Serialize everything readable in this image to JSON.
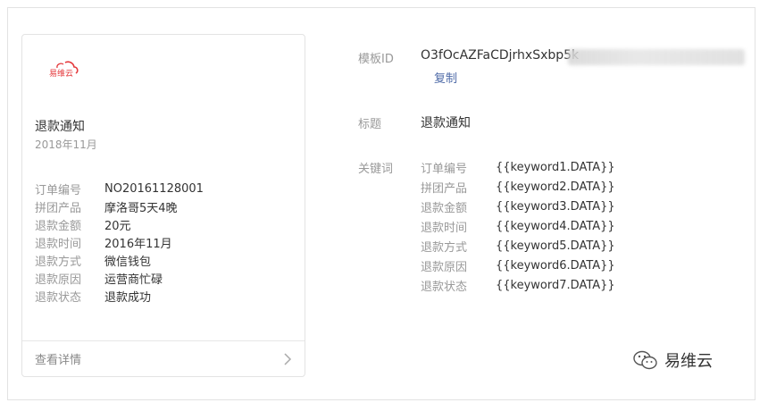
{
  "card": {
    "logo_text": "易维云",
    "title": "退款通知",
    "date": "2018年11月",
    "fields": [
      {
        "label": "订单编号",
        "value": "NO20161128001"
      },
      {
        "label": "拼团产品",
        "value": "摩洛哥5天4晚"
      },
      {
        "label": "退款金额",
        "value": "20元"
      },
      {
        "label": "退款时间",
        "value": "2016年11月"
      },
      {
        "label": "退款方式",
        "value": "微信钱包"
      },
      {
        "label": "退款原因",
        "value": "运营商忙碌"
      },
      {
        "label": "退款状态",
        "value": "退款成功"
      }
    ],
    "footer_link": "查看详情"
  },
  "info": {
    "template_id_label": "模板ID",
    "template_id_value": "O3fOcAZFaCDjrhxSxbp5k",
    "copy_label": "复制",
    "title_label": "标题",
    "title_value": "退款通知",
    "keywords_label": "关键词",
    "keywords": [
      {
        "name": "订单编号",
        "value": "{{keyword1.DATA}}"
      },
      {
        "name": "拼团产品",
        "value": "{{keyword2.DATA}}"
      },
      {
        "name": "退款金额",
        "value": "{{keyword3.DATA}}"
      },
      {
        "name": "退款时间",
        "value": "{{keyword4.DATA}}"
      },
      {
        "name": "退款方式",
        "value": "{{keyword5.DATA}}"
      },
      {
        "name": "退款原因",
        "value": "{{keyword6.DATA}}"
      },
      {
        "name": "退款状态",
        "value": "{{keyword7.DATA}}"
      }
    ]
  },
  "watermark": {
    "text": "易维云",
    "icon": "wechat-icon"
  },
  "colors": {
    "brand_red": "#e4393c",
    "link_blue": "#4f6ba8"
  }
}
